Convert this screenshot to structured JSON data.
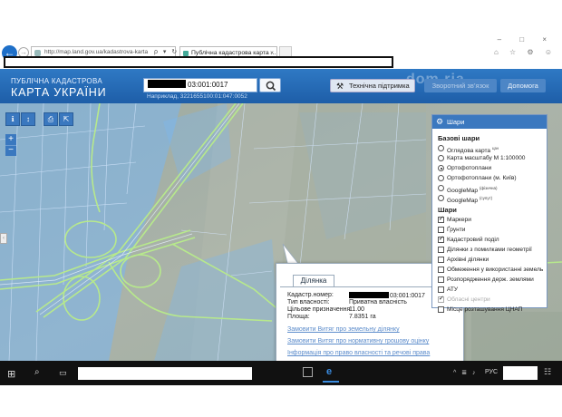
{
  "browser": {
    "address": "http://map.land.gov.ua/kadastrova-karta",
    "address_tools": "ρ ▾ ↻",
    "tab_title": "Публічна кадастрова карта ...",
    "tab_close": "×",
    "back_icon": "←",
    "forward_icon": "→",
    "window_controls": "– □ ×",
    "toolbar_icons": "⌂ ☆ ⚙ ☺"
  },
  "site": {
    "logo_sub": "ПУБЛІЧНА КАДАСТРОВА",
    "logo_main": "КАРТА УКРАЇНИ",
    "search_value_visible": "03:001:0017",
    "search_hint": "Наприклад, 3221655100:01:047:0052",
    "support_label": "Технічна підтримка",
    "feedback_label": "Зворотний зв’язок",
    "help_label": "Допомога",
    "watermark": "dom.ria",
    "support_icon": "⚒"
  },
  "map_tools": [
    "ℹ",
    "↕",
    "⎙",
    "⇱"
  ],
  "zoom": {
    "in": "+",
    "out": "−"
  },
  "left_tab": "‹",
  "popup": {
    "tab": "Ділянка",
    "rows": [
      {
        "key": "Кадастр.номер:",
        "value": "03:001:0017"
      },
      {
        "key": "Тип власності:",
        "value": "Приватна власність"
      },
      {
        "key": "Цільове призначення:",
        "value": "11.00"
      },
      {
        "key": "Площа:",
        "value": "7.8351 га"
      }
    ],
    "links": [
      "Замовити Витяг про земельну ділянку",
      "Замовити Витяг про нормативну грошову оцінку",
      "Інформація про право власності та речові права"
    ]
  },
  "layers": {
    "title": "Шари",
    "gear_icon": "⚙",
    "base_title": "Базові шари",
    "base": [
      {
        "label": "Оглядова карта",
        "sup": "цзн",
        "selected": false
      },
      {
        "label": "Карта масштабу М 1:100000",
        "sup": "",
        "selected": false
      },
      {
        "label": "Ортофотоплани",
        "sup": "",
        "selected": true
      },
      {
        "label": "Ортофотоплани (м. Київ)",
        "sup": "",
        "selected": false
      },
      {
        "label": "GoogleMap",
        "sup": "(фізична)",
        "selected": false
      },
      {
        "label": "GoogleMap",
        "sup": "(супут)",
        "selected": false
      }
    ],
    "layers_title": "Шари",
    "overlays": [
      {
        "label": "Маркери",
        "checked": true,
        "disabled": false
      },
      {
        "label": "Ґрунти",
        "checked": false,
        "disabled": false
      },
      {
        "label": "Кадастровий поділ",
        "checked": true,
        "disabled": false
      },
      {
        "label": "Ділянки з помилками геометрії",
        "checked": false,
        "disabled": false
      },
      {
        "label": "Архівні ділянки",
        "checked": false,
        "disabled": false
      },
      {
        "label": "Обмеження у використанні земель",
        "checked": false,
        "disabled": false
      },
      {
        "label": "Розпорядження держ. землями",
        "checked": false,
        "disabled": false
      },
      {
        "label": "АТУ",
        "checked": false,
        "disabled": false
      },
      {
        "label": "Обласні центри",
        "checked": true,
        "disabled": true
      },
      {
        "label": "Місце розташування ЦНАП",
        "checked": false,
        "disabled": false
      }
    ]
  },
  "taskbar": {
    "start": "⊞",
    "search": "⌕",
    "task_view": "▭",
    "app_ie": "e",
    "tray": "^ ≣ ♪",
    "lang": "РУС",
    "notify": "☷"
  },
  "colors": {
    "header": "#1e5ea8",
    "panel_header": "#3b78bf",
    "cadastre_overlay": "#7ab7f0",
    "road_lines": "#b7e98c",
    "link": "#5c8ccb"
  }
}
